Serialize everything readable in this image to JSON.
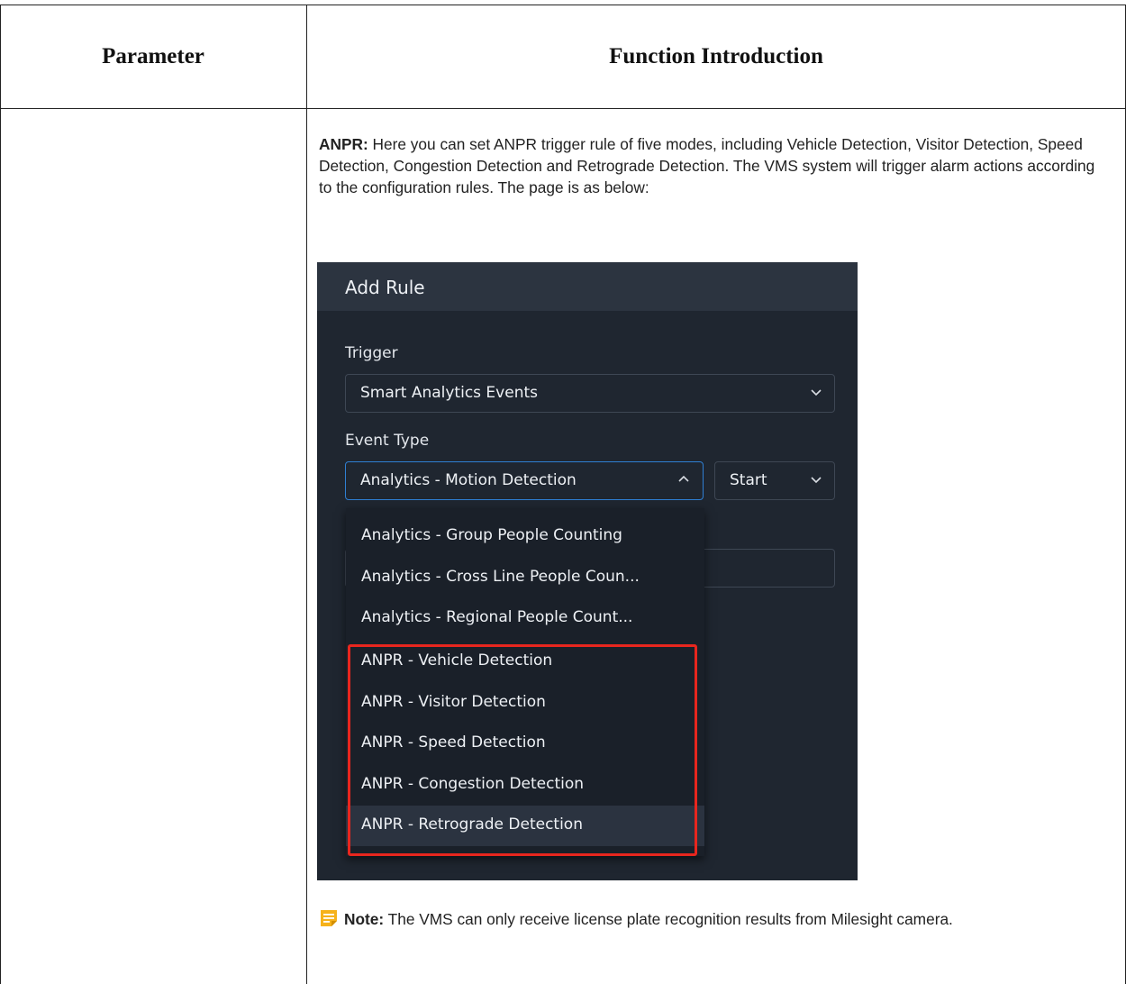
{
  "table": {
    "header_parameter": "Parameter",
    "header_function": "Function Introduction"
  },
  "intro": {
    "label": "ANPR:",
    "text": " Here you can set ANPR trigger rule of five modes, including Vehicle Detection, Visitor Detection, Speed Detection, Congestion Detection and Retrograde Detection. The VMS system will trigger alarm actions according to the configuration rules. The page is as below:"
  },
  "screenshot": {
    "title": "Add Rule",
    "trigger_label": "Trigger",
    "trigger_value": "Smart Analytics Events",
    "event_type_label": "Event Type",
    "event_type_value": "Analytics - Motion Detection",
    "state_value": "Start",
    "options": [
      "Analytics - Group People Counting",
      "Analytics - Cross Line People Coun...",
      "Analytics - Regional People Count...",
      "ANPR - Vehicle Detection",
      "ANPR - Visitor Detection",
      "ANPR - Speed Detection",
      "ANPR - Congestion Detection",
      "ANPR - Retrograde Detection"
    ],
    "highlighted_option": "ANPR - Retrograde Detection",
    "colors": {
      "panel": "#1f2630",
      "header": "#2c3440",
      "focus": "#2f7fd3",
      "highlight": "#e8261e"
    }
  },
  "note": {
    "label": "Note:",
    "text": "  The VMS can only receive license plate recognition results from Milesight camera.",
    "icon": "note-icon"
  }
}
